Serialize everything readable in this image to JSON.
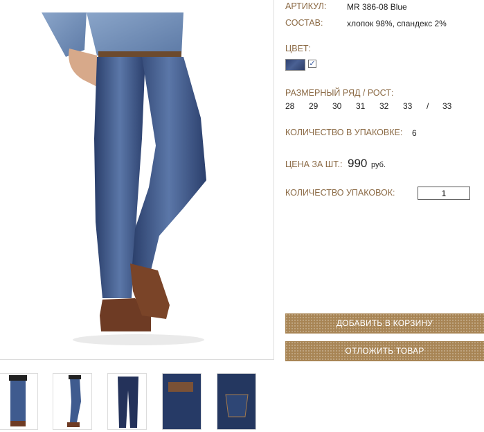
{
  "product": {
    "sku_label": "АРТИКУЛ:",
    "sku_value": "MR 386-08 Blue",
    "composition_label": "СОСТАВ:",
    "composition_value": "хлопок 98%, спандекс 2%",
    "color_label": "ЦВЕТ:",
    "color_swatch": "#3b4f78",
    "color_checked": "✓",
    "sizes_label": "РАЗМЕРНЫЙ РЯД / РОСТ:",
    "sizes": [
      "28",
      "29",
      "30",
      "31",
      "32",
      "33",
      "/",
      "33"
    ],
    "pack_qty_label": "КОЛИЧЕСТВО В УПАКОВКЕ:",
    "pack_qty_value": "6",
    "price_label": "ЦЕНА ЗА ШТ.:",
    "price_value": "990",
    "price_currency": "руб.",
    "packs_label": "КОЛИЧЕСТВО УПАКОВОК:",
    "packs_value": "1"
  },
  "actions": {
    "add_to_cart": "ДОБАВИТЬ В КОРЗИНУ",
    "postpone": "ОТЛОЖИТЬ ТОВАР"
  },
  "colors": {
    "label": "#8b6a45",
    "button": "#a88555",
    "denim": "#3b4f78"
  }
}
